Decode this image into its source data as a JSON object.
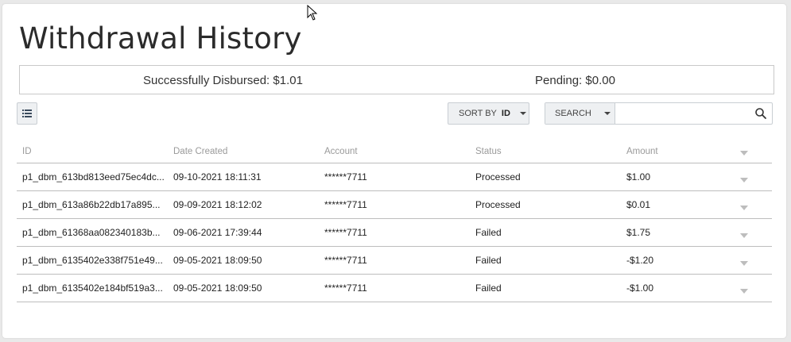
{
  "page": {
    "title": "Withdrawal History"
  },
  "summary": {
    "disbursed": "Successfully Disbursed: $1.01",
    "pending": "Pending: $0.00"
  },
  "toolbar": {
    "list_icon": "list-icon",
    "sort_label": "SORT BY",
    "sort_value": "ID",
    "search_type_label": "SEARCH",
    "search_placeholder": "",
    "search_icon": "search-icon"
  },
  "table": {
    "headers": {
      "id": "ID",
      "date": "Date Created",
      "account": "Account",
      "status": "Status",
      "amount": "Amount"
    },
    "rows": [
      {
        "id": "p1_dbm_613bd813eed75ec4dc...",
        "date": "09-10-2021 18:11:31",
        "account": "******7711",
        "status": "Processed",
        "amount": "$1.00"
      },
      {
        "id": "p1_dbm_613a86b22db17a895...",
        "date": "09-09-2021 18:12:02",
        "account": "******7711",
        "status": "Processed",
        "amount": "$0.01"
      },
      {
        "id": "p1_dbm_61368aa082340183b...",
        "date": "09-06-2021 17:39:44",
        "account": "******7711",
        "status": "Failed",
        "amount": "$1.75"
      },
      {
        "id": "p1_dbm_6135402e338f751e49...",
        "date": "09-05-2021 18:09:50",
        "account": "******7711",
        "status": "Failed",
        "amount": "-$1.20"
      },
      {
        "id": "p1_dbm_6135402e184bf519a3...",
        "date": "09-05-2021 18:09:50",
        "account": "******7711",
        "status": "Failed",
        "amount": "-$1.00"
      }
    ]
  },
  "colors": {
    "border": "#bdbdbd",
    "button_bg": "#eef0f2",
    "header_text": "#9a9a9a"
  }
}
